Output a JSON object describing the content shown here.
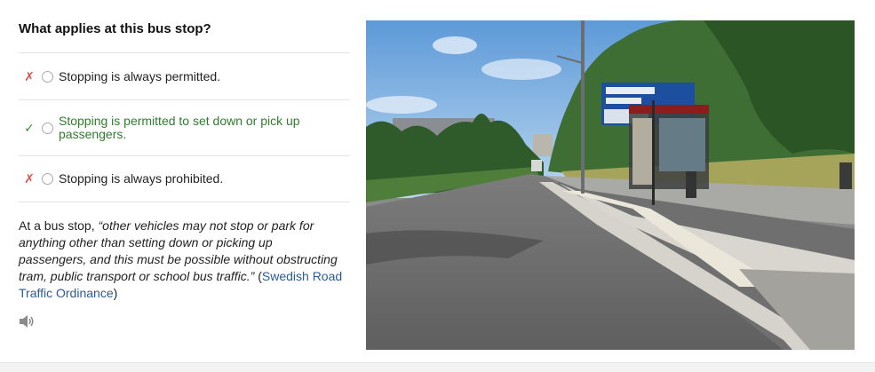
{
  "question": "What applies at this bus stop?",
  "answers": [
    {
      "mark": "✗",
      "label": "Stopping is always permitted.",
      "correct": false
    },
    {
      "mark": "✓",
      "label": "Stopping is permitted to set down or pick up passengers.",
      "correct": true
    },
    {
      "mark": "✗",
      "label": "Stopping is always prohibited.",
      "correct": false
    }
  ],
  "explanation": {
    "prefix": "At a bus stop, ",
    "quote": "“other vehicles may not stop or park for anything other than setting down or picking up passengers, and this must be possible without obstructing tram, public transport or school bus traffic.”",
    "open_paren": " (",
    "source_link": "Swedish Road Traffic Ordinance",
    "close_paren": ")"
  },
  "icons": {
    "audio": "speaker-icon"
  },
  "colors": {
    "correct": "#2f7d2f",
    "wrong": "#d9534f",
    "link": "#2a5a9c"
  }
}
